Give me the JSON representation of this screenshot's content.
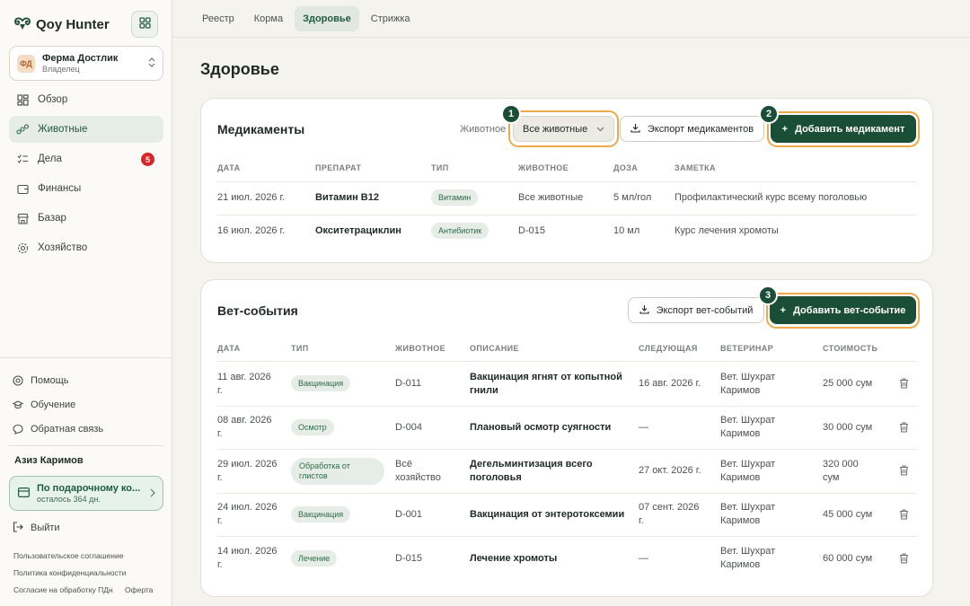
{
  "brand": {
    "name": "Qoy Hunter"
  },
  "farm": {
    "initials": "ФД",
    "name": "Ферма Достлик",
    "role": "Владелец"
  },
  "nav": {
    "items": [
      {
        "label": "Обзор"
      },
      {
        "label": "Животные"
      },
      {
        "label": "Дела",
        "badge": "5"
      },
      {
        "label": "Финансы"
      },
      {
        "label": "Базар"
      },
      {
        "label": "Хозяйство"
      }
    ]
  },
  "support": {
    "help": "Помощь",
    "learning": "Обучение",
    "feedback": "Обратная связь"
  },
  "user": {
    "name": "Азиз Каримов"
  },
  "plan": {
    "title": "По подарочному ко...",
    "subtitle": "осталось 364 дн."
  },
  "logout": "Выйти",
  "legal": {
    "agreement": "Пользовательское соглашение",
    "privacy": "Политика конфиденциальности",
    "consent": "Согласие на обработку ПДн",
    "offer": "Оферта"
  },
  "tabs": [
    "Реестр",
    "Корма",
    "Здоровье",
    "Стрижка"
  ],
  "page": {
    "title": "Здоровье"
  },
  "medications": {
    "title": "Медикаменты",
    "filter_label": "Животное",
    "filter_value": "Все животные",
    "export_label": "Экспорт медикаментов",
    "add_label": "Добавить медикамент",
    "markers": [
      "1",
      "2"
    ],
    "columns": [
      "ДАТА",
      "ПРЕПАРАТ",
      "ТИП",
      "ЖИВОТНОЕ",
      "ДОЗА",
      "ЗАМЕТКА"
    ],
    "rows": [
      {
        "date": "21 июл. 2026 г.",
        "drug": "Витамин B12",
        "type": "Витамин",
        "animal": "Все животные",
        "dose": "5 мл/гол",
        "note": "Профилактический курс всему поголовью"
      },
      {
        "date": "16 июл. 2026 г.",
        "drug": "Окситетрациклин",
        "type": "Антибиотик",
        "animal": "D-015",
        "dose": "10 мл",
        "note": "Курс лечения хромоты"
      }
    ]
  },
  "vet": {
    "title": "Вет-события",
    "export_label": "Экспорт вет-событий",
    "add_label": "Добавить вет-событие",
    "marker": "3",
    "columns": [
      "ДАТА",
      "ТИП",
      "ЖИВОТНОЕ",
      "ОПИСАНИЕ",
      "СЛЕДУЮЩАЯ",
      "ВЕТЕРИНАР",
      "СТОИМОСТЬ"
    ],
    "rows": [
      {
        "date1": "11 авг. 2026",
        "date2": "г.",
        "type1": "Вакцинация",
        "type2": "",
        "animal1": "D-011",
        "animal2": "",
        "desc1": "Вакцинация ягнят от копытной",
        "desc2": "гнили",
        "next": "16 авг. 2026 г.",
        "vet1": "Вет. Шухрат",
        "vet2": "Каримов",
        "cost1": "25 000 сум",
        "cost2": ""
      },
      {
        "date1": "08 авг. 2026",
        "date2": "г.",
        "type1": "Осмотр",
        "type2": "",
        "animal1": "D-004",
        "animal2": "",
        "desc1": "Плановый осмотр суягности",
        "desc2": "",
        "next": "—",
        "vet1": "Вет. Шухрат",
        "vet2": "Каримов",
        "cost1": "30 000 сум",
        "cost2": ""
      },
      {
        "date1": "29 июл. 2026",
        "date2": "г.",
        "type1": "Обработка от",
        "type2": "глистов",
        "animal1": "Всё",
        "animal2": "хозяйство",
        "desc1": "Дегельминтизация всего",
        "desc2": "поголовья",
        "next": "27 окт. 2026 г.",
        "vet1": "Вет. Шухрат",
        "vet2": "Каримов",
        "cost1": "320 000",
        "cost2": "сум"
      },
      {
        "date1": "24 июл. 2026",
        "date2": "г.",
        "type1": "Вакцинация",
        "type2": "",
        "animal1": "D-001",
        "animal2": "",
        "desc1": "Вакцинация от энтеротоксемии",
        "desc2": "",
        "next1": "07 сент. 2026",
        "next2": "г.",
        "vet1": "Вет. Шухрат",
        "vet2": "Каримов",
        "cost1": "45 000 сум",
        "cost2": ""
      },
      {
        "date1": "14 июл. 2026",
        "date2": "г.",
        "type1": "Лечение",
        "type2": "",
        "animal1": "D-015",
        "animal2": "",
        "desc1": "Лечение хромоты",
        "desc2": "",
        "next": "—",
        "vet1": "Вет. Шухрат",
        "vet2": "Каримов",
        "cost1": "60 000 сум",
        "cost2": ""
      }
    ]
  }
}
